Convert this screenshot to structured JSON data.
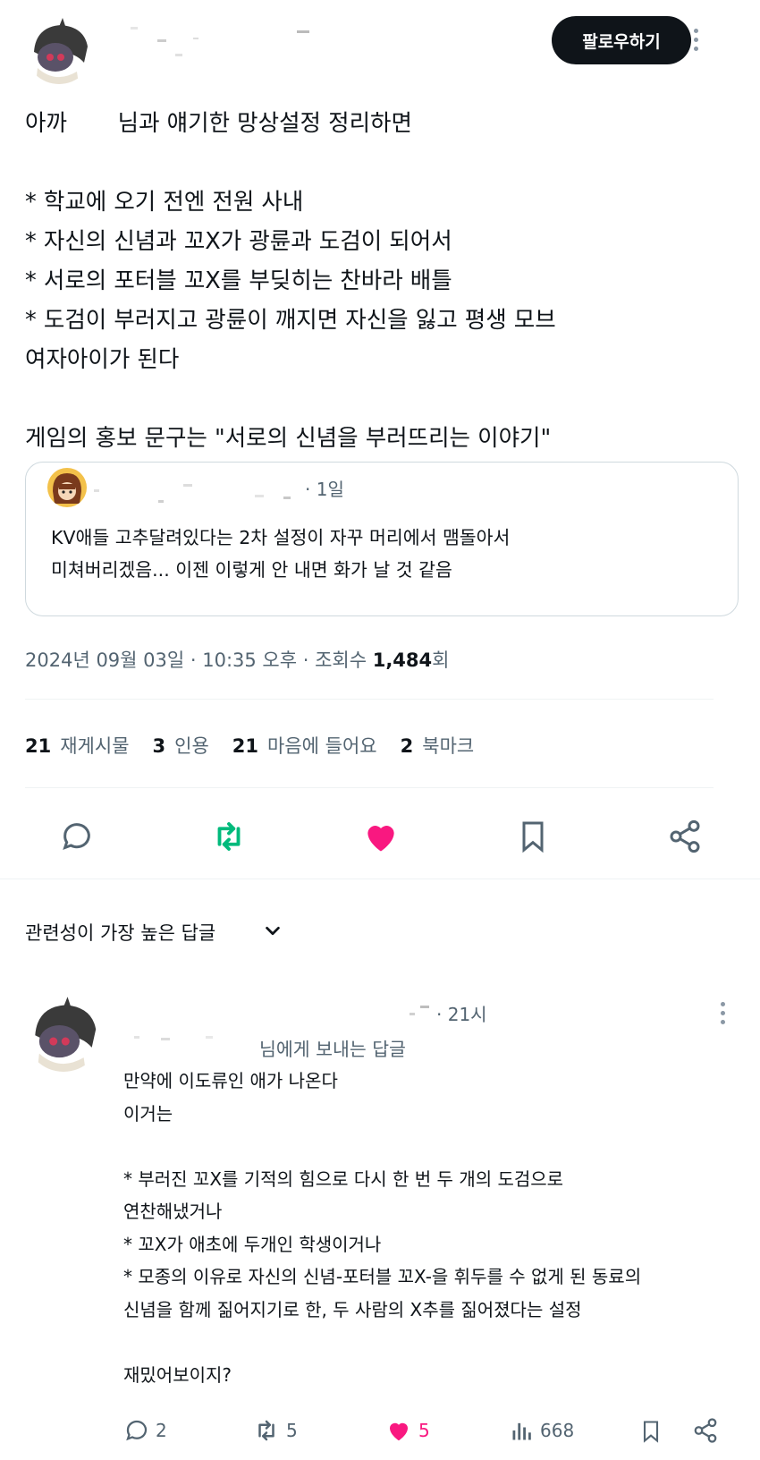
{
  "post": {
    "follow_label": "팔로우하기",
    "text": "아까       님과 얘기한 망상설정 정리하면\n\n* 학교에 오기 전엔 전원 사내\n* 자신의 신념과 꼬X가 광륜과 도검이 되어서\n* 서로의 포터블 꼬X를 부딪히는 찬바라 배틀\n* 도검이 부러지고 광륜이 깨지면 자신을 잃고 평생 모브\n여자아이가 된다\n\n게임의 홍보 문구는 \"서로의 신념을 부러뜨리는 이야기\"",
    "timestamp_prefix": "2024년 09월 03일 · 10:35 오후 · 조회수 ",
    "views": "1,484",
    "views_suffix": "회"
  },
  "quote": {
    "meta": "· 1일",
    "text": "KV애들 고추달려있다는 2차 설정이 자꾸 머리에서 맴돌아서\n미쳐버리겠음... 이젠 이렇게 안 내면 화가 날 것 같음"
  },
  "stats": {
    "reposts_count": "21",
    "reposts_label": "재게시물",
    "quotes_count": "3",
    "quotes_label": "인용",
    "likes_count": "21",
    "likes_label": "마음에 들어요",
    "bookmarks_count": "2",
    "bookmarks_label": "북마크"
  },
  "sort": {
    "label": "관련성이 가장 높은 답글"
  },
  "reply": {
    "meta": "· 21시",
    "reply_to": "님에게 보내는 답글",
    "text": "만약에 이도류인 애가 나온다\n이거는\n\n* 부러진 꼬X를 기적의 힘으로 다시 한 번 두 개의 도검으로\n연찬해냈거나\n* 꼬X가 애초에 두개인 학생이거나\n* 모종의 이유로 자신의 신념-포터블 꼬X-을 휘두를 수 없게 된 동료의\n신념을 함께 짊어지기로 한, 두 사람의 X추를 짊어졌다는 설정\n\n재밌어보이지?",
    "replies": "2",
    "reposts": "5",
    "likes": "5",
    "views": "668"
  },
  "colors": {
    "like": "#f91880",
    "repost": "#00ba7c",
    "muted": "#536471"
  }
}
